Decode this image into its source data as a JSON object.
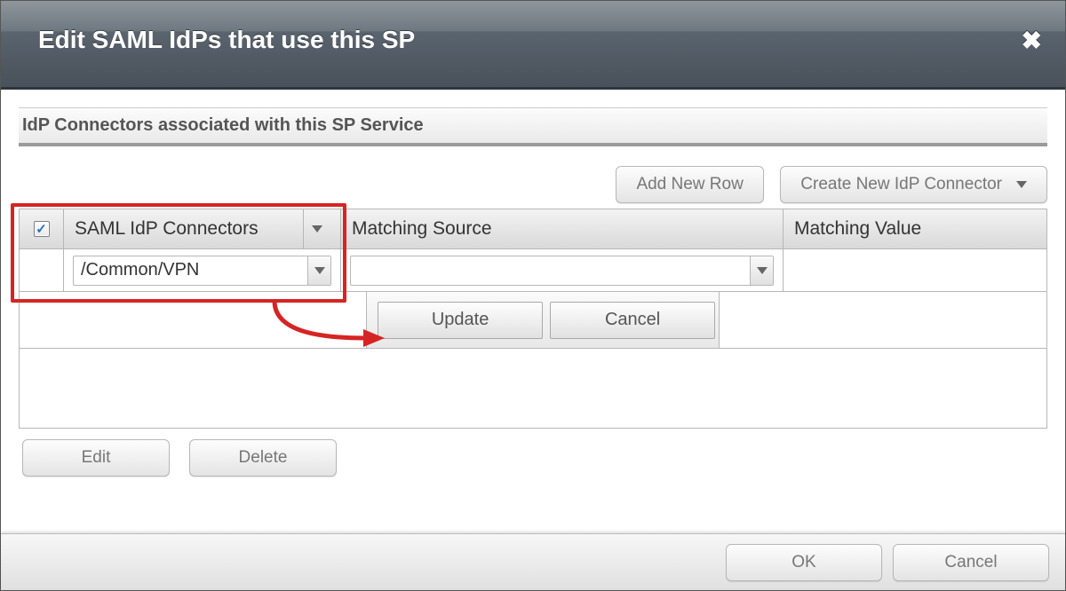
{
  "dialog": {
    "title": "Edit SAML IdPs that use this SP"
  },
  "section": {
    "title": "IdP Connectors associated with this SP Service"
  },
  "toolbar": {
    "add_row": "Add New Row",
    "create_idp": "Create New IdP Connector"
  },
  "grid": {
    "columns": {
      "connectors": "SAML IdP Connectors",
      "source": "Matching Source",
      "value": "Matching Value"
    },
    "header_checked": true,
    "rows": [
      {
        "connector": "/Common/VPN",
        "source": "",
        "value": ""
      }
    ]
  },
  "row_edit": {
    "update": "Update",
    "cancel": "Cancel"
  },
  "bottom": {
    "edit": "Edit",
    "delete": "Delete"
  },
  "footer": {
    "ok": "OK",
    "cancel": "Cancel"
  }
}
